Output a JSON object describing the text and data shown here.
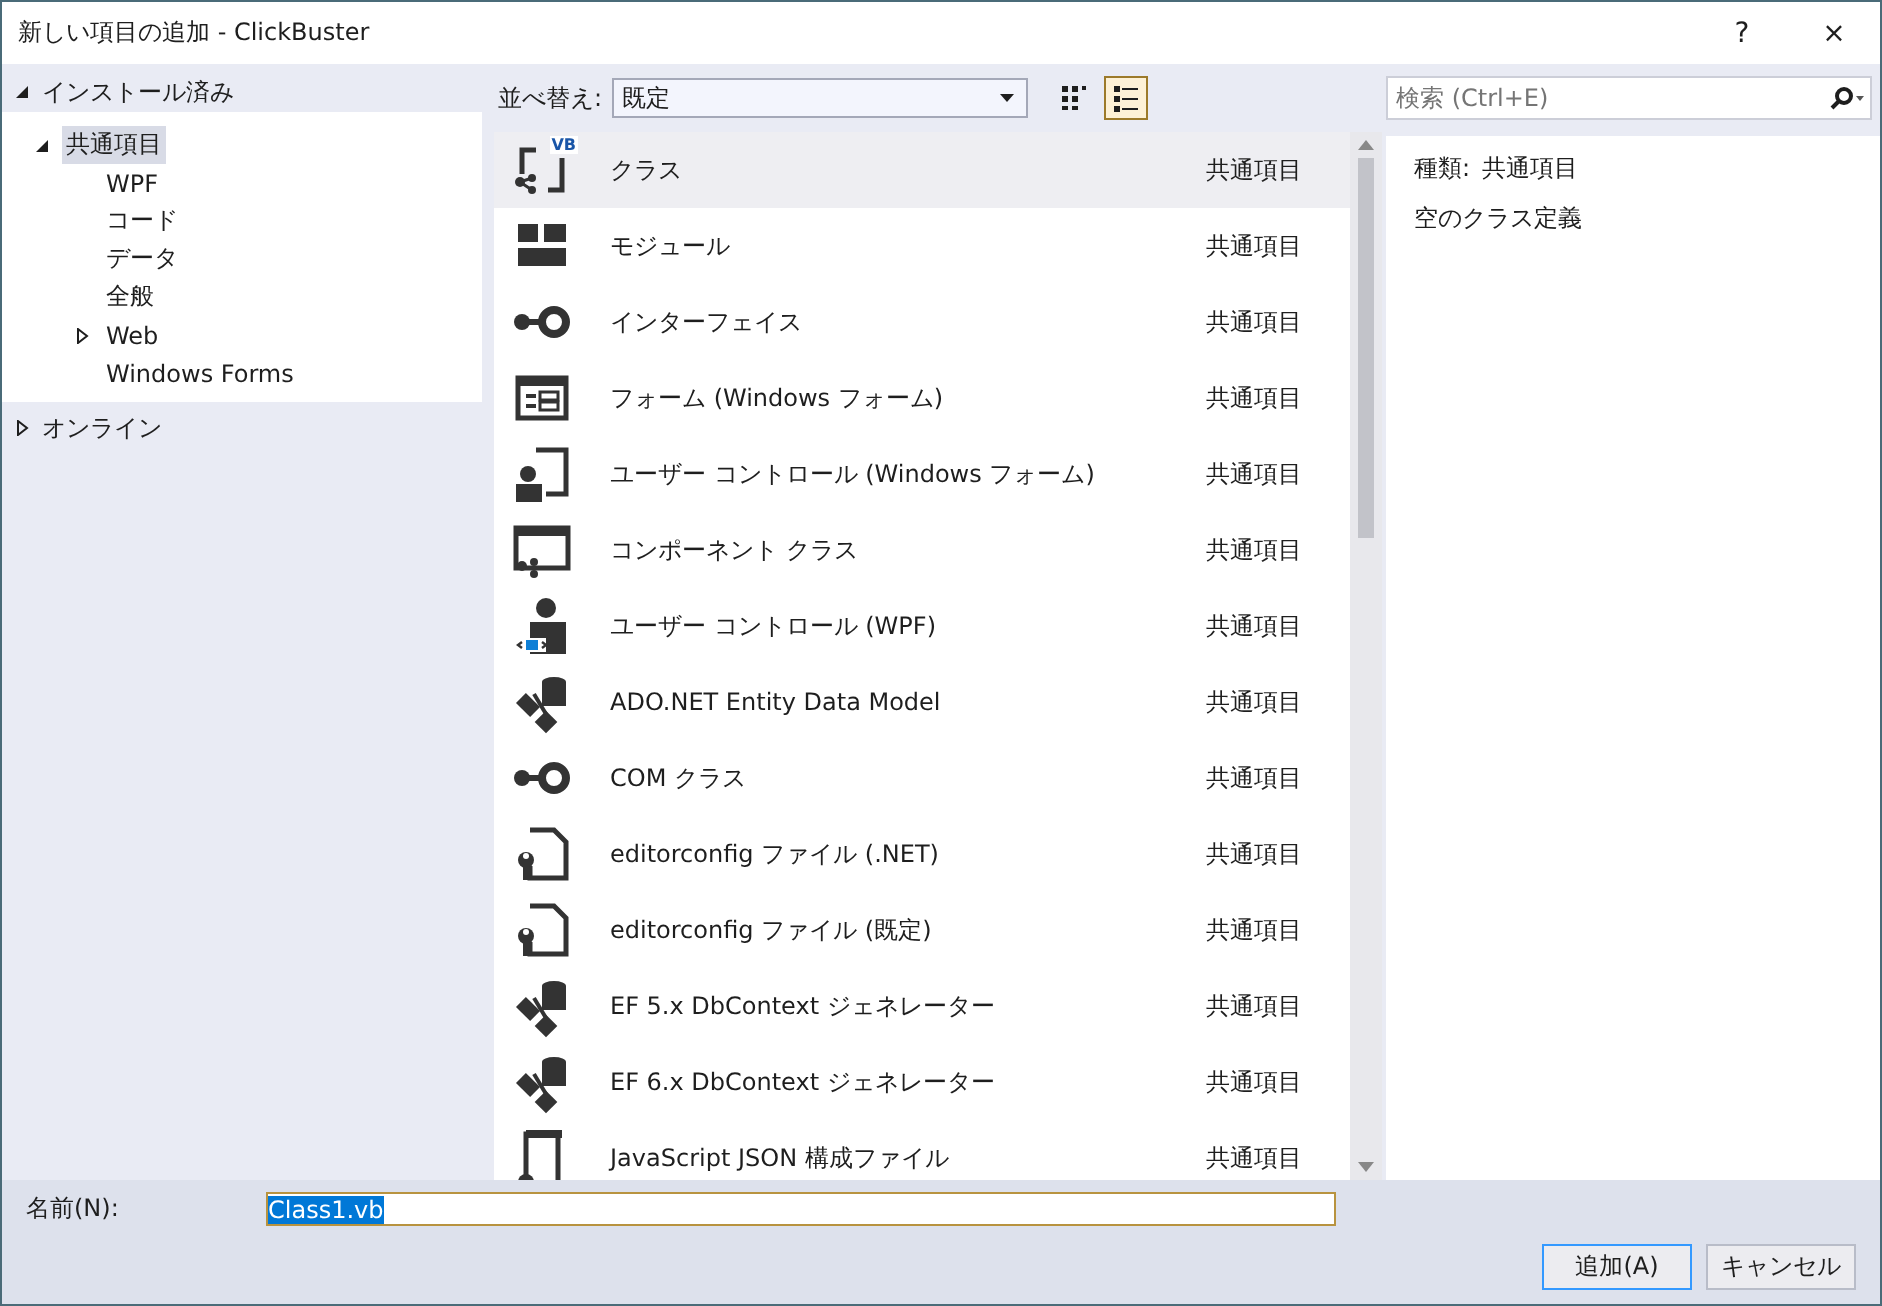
{
  "window": {
    "title": "新しい項目の追加 - ClickBuster",
    "help": "?",
    "close": "×"
  },
  "sidebar": {
    "sections": [
      {
        "label": "インストール済み",
        "expanded": true,
        "children": [
          {
            "label": "共通項目",
            "expanded": true,
            "selected": true,
            "children": [
              {
                "label": "WPF",
                "selected": false
              },
              {
                "label": "コード",
                "selected": false
              },
              {
                "label": "データ",
                "selected": false
              },
              {
                "label": "全般",
                "selected": false
              },
              {
                "label": "Web",
                "expanded": false,
                "selected": false
              },
              {
                "label": "Windows Forms",
                "selected": false
              }
            ]
          }
        ]
      },
      {
        "label": "オンライン",
        "expanded": false
      }
    ]
  },
  "toolbar": {
    "sort_label": "並べ替え:",
    "sort_value": "既定",
    "views": [
      {
        "kind": "grid",
        "selected": false
      },
      {
        "kind": "list",
        "selected": true
      }
    ]
  },
  "search": {
    "placeholder": "検索 (Ctrl+E)"
  },
  "items": [
    {
      "kind": "class",
      "badge": "VB",
      "name": "クラス",
      "category": "共通項目",
      "selected": true
    },
    {
      "kind": "module",
      "name": "モジュール",
      "category": "共通項目",
      "selected": false
    },
    {
      "kind": "interface",
      "name": "インターフェイス",
      "category": "共通項目",
      "selected": false
    },
    {
      "kind": "form",
      "name": "フォーム (Windows フォーム)",
      "category": "共通項目",
      "selected": false
    },
    {
      "kind": "usercontrol",
      "name": "ユーザー コントロール (Windows フォーム)",
      "category": "共通項目",
      "selected": false
    },
    {
      "kind": "component",
      "name": "コンポーネント クラス",
      "category": "共通項目",
      "selected": false
    },
    {
      "kind": "wpfcontrol",
      "name": "ユーザー コントロール (WPF)",
      "category": "共通項目",
      "selected": false
    },
    {
      "kind": "entity",
      "name": "ADO.NET Entity Data Model",
      "category": "共通項目",
      "selected": false
    },
    {
      "kind": "interface",
      "name": "COM クラス",
      "category": "共通項目",
      "selected": false
    },
    {
      "kind": "config",
      "name": "editorconfig ファイル (.NET)",
      "category": "共通項目",
      "selected": false
    },
    {
      "kind": "config",
      "name": "editorconfig ファイル (既定)",
      "category": "共通項目",
      "selected": false
    },
    {
      "kind": "entity",
      "name": "EF 5.x DbContext ジェネレーター",
      "category": "共通項目",
      "selected": false
    },
    {
      "kind": "entity",
      "name": "EF 6.x DbContext ジェネレーター",
      "category": "共通項目",
      "selected": false
    },
    {
      "kind": "json",
      "name": "JavaScript JSON 構成ファイル",
      "category": "共通項目",
      "selected": false
    }
  ],
  "details": {
    "type_label": "種類:",
    "type_value": "共通項目",
    "description": "空のクラス定義"
  },
  "name_field": {
    "label": "名前(N):",
    "value": "Class1.vb",
    "text_selected": true
  },
  "buttons": [
    {
      "label": "追加(A)",
      "default": true
    },
    {
      "label": "キャンセル",
      "default": false
    }
  ]
}
